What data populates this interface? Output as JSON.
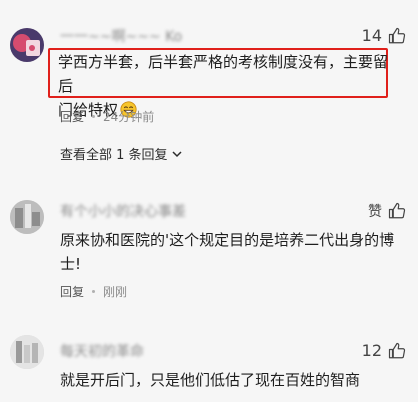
{
  "comments": [
    {
      "name": "一一~~啊~~~ Ko",
      "likes": "14",
      "content_line1": "学西方半套，后半套严格的考核制度没有，主要留后",
      "content_line2": "门给特权",
      "reply_label": "回复",
      "time": "24分钟前",
      "view_all": "查看全部 1 条回复",
      "avatar_colors": [
        "#4a3a6b",
        "#d64c6f",
        "#f2d7e0"
      ]
    },
    {
      "name": "有个小小的决心事差",
      "likes": "赞",
      "content_line1": "原来协和医院的'这个规定目的是培养二代出身的博",
      "content_line2": "士!",
      "reply_label": "回复",
      "time": "刚刚",
      "avatar_colors": [
        "#8d8d8d",
        "#bdbdbd",
        "#e7e7e7"
      ]
    },
    {
      "name": "每天初的革命",
      "likes": "12",
      "content_line1": "就是开后门，只是他们低估了现在百姓的智商",
      "avatar_colors": [
        "#9a9a9a",
        "#c9c9c9",
        "#eeeeee"
      ]
    }
  ]
}
